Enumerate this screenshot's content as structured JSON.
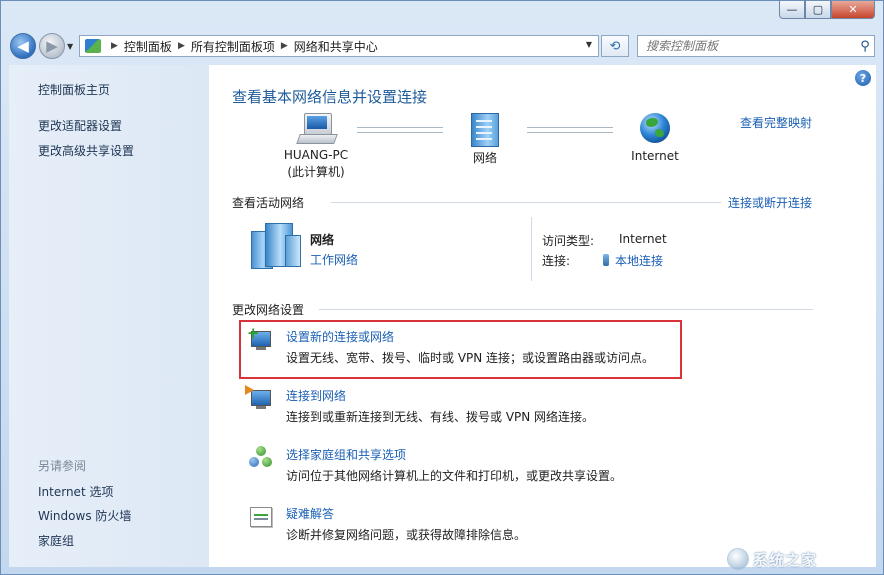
{
  "window": {
    "buttons": {
      "minimize": "—",
      "maximize": "▢",
      "close": "✕"
    }
  },
  "nav": {
    "back": "◀",
    "forward": "▶",
    "breadcrumbs": [
      "控制面板",
      "所有控制面板项",
      "网络和共享中心"
    ],
    "search_placeholder": "搜索控制面板"
  },
  "sidebar": {
    "home": "控制面板主页",
    "links": [
      "更改适配器设置",
      "更改高级共享设置"
    ],
    "see_also_heading": "另请参阅",
    "see_also": [
      "Internet 选项",
      "Windows 防火墙",
      "家庭组"
    ]
  },
  "main": {
    "help": "?",
    "title": "查看基本网络信息并设置连接",
    "full_map": "查看完整映射",
    "map": {
      "computer": {
        "name": "HUANG-PC",
        "sub": "(此计算机)"
      },
      "network": {
        "name": "网络"
      },
      "internet": {
        "name": "Internet"
      }
    },
    "active": {
      "heading": "查看活动网络",
      "connect_link": "连接或断开连接",
      "network_name": "网络",
      "network_type": "工作网络",
      "access_label": "访问类型:",
      "access_value": "Internet",
      "conn_label": "连接:",
      "conn_value": "本地连接"
    },
    "change": {
      "heading": "更改网络设置",
      "tasks": [
        {
          "title": "设置新的连接或网络",
          "desc": "设置无线、宽带、拨号、临时或 VPN 连接；或设置路由器或访问点。",
          "icon": "new-connection-icon"
        },
        {
          "title": "连接到网络",
          "desc": "连接到或重新连接到无线、有线、拨号或 VPN 网络连接。",
          "icon": "connect-network-icon"
        },
        {
          "title": "选择家庭组和共享选项",
          "desc": "访问位于其他网络计算机上的文件和打印机，或更改共享设置。",
          "icon": "homegroup-icon"
        },
        {
          "title": "疑难解答",
          "desc": "诊断并修复网络问题，或获得故障排除信息。",
          "icon": "troubleshoot-icon"
        }
      ]
    }
  },
  "watermark": {
    "text": "系统之家"
  },
  "colors": {
    "link": "#1a5fb4",
    "title": "#1f5b9a",
    "highlight": "#d8333a",
    "sidebar_bg": "#e2ebf7"
  }
}
